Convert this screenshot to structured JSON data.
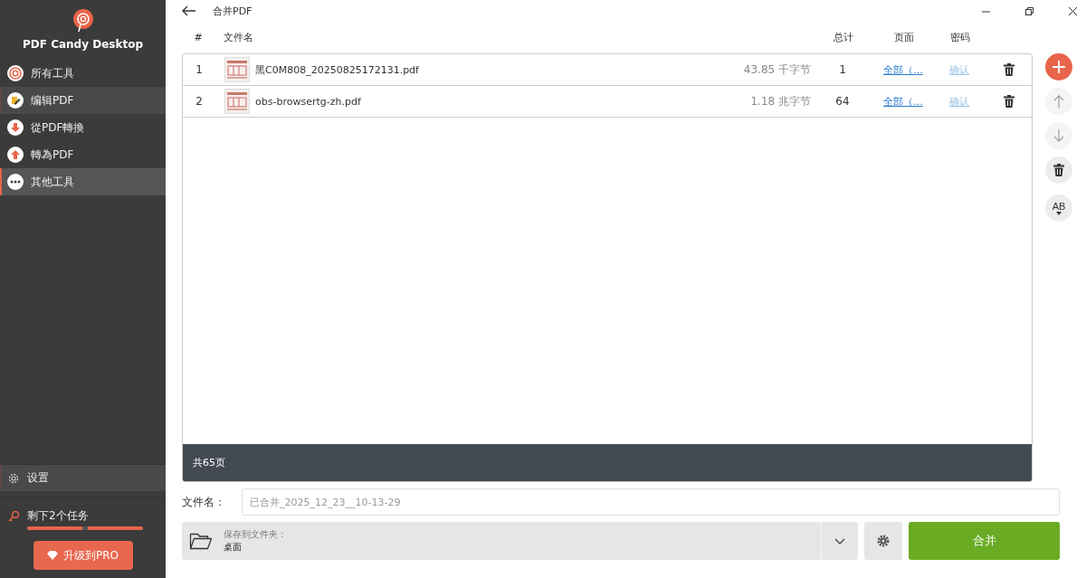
{
  "app": {
    "name": "PDF Candy Desktop"
  },
  "sidebar": {
    "items": [
      {
        "label": "所有工具",
        "kind": "spiral",
        "selected": false,
        "highlighted": false
      },
      {
        "label": "编辑PDF",
        "kind": "edit",
        "selected": false,
        "highlighted": true
      },
      {
        "label": "從PDF轉換",
        "kind": "down",
        "selected": false,
        "highlighted": false
      },
      {
        "label": "轉為PDF",
        "kind": "up",
        "selected": false,
        "highlighted": false
      },
      {
        "label": "其他工具",
        "kind": "more",
        "selected": true,
        "highlighted": false
      }
    ],
    "settings": {
      "label": "设置",
      "highlighted": true
    },
    "tasks": {
      "label": "剩下2个任务",
      "level": 1
    },
    "upgrade": "升级到PRO"
  },
  "window": {
    "title": "合并PDF"
  },
  "table": {
    "columns": [
      "#",
      "文件名",
      "总计",
      "页面",
      "密码"
    ],
    "rows": [
      {
        "index": "1",
        "name": "黑C0M808_20250825172131.pdf",
        "size": "43.85 千字节",
        "total": "1",
        "pages": "全部（...",
        "password": "确认"
      },
      {
        "index": "2",
        "name": "obs-browsertg-zh.pdf",
        "size": "1.18 兆字节",
        "total": "64",
        "pages": "全部（...",
        "password": "确认"
      }
    ],
    "footer": "共65页"
  },
  "filename": {
    "label": "文件名：",
    "placeholder": "已合并_2025_12_23__10-13-29"
  },
  "save": {
    "label": "保存到文件夹：",
    "value": "桌面"
  },
  "merge_button": "合并",
  "side_buttons": [
    {
      "kind": "add",
      "disabled": false
    },
    {
      "kind": "up",
      "disabled": true
    },
    {
      "kind": "down",
      "disabled": true
    },
    {
      "kind": "delete",
      "disabled": false
    },
    {
      "kind": "sort",
      "disabled": false,
      "label": "AB"
    }
  ]
}
